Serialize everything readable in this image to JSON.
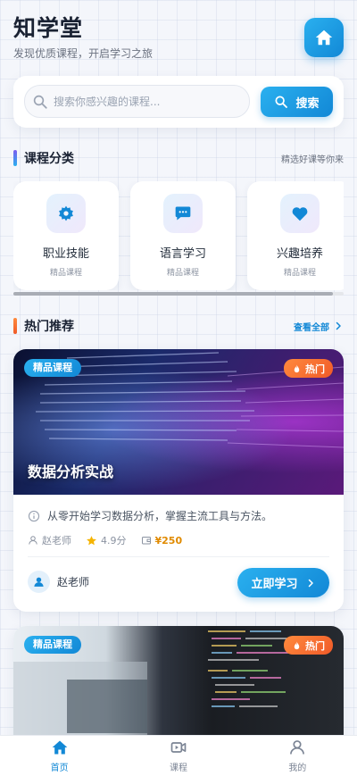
{
  "header": {
    "title": "知学堂",
    "subtitle": "发现优质课程，开启学习之旅"
  },
  "search": {
    "placeholder": "搜索你感兴趣的课程...",
    "button_label": "搜索"
  },
  "categories_section": {
    "title": "课程分类",
    "right_text": "精选好课等你来",
    "items": [
      {
        "label": "职业技能",
        "sub": "精品课程",
        "icon": "gear-icon"
      },
      {
        "label": "语言学习",
        "sub": "精品课程",
        "icon": "chat-bubble-icon"
      },
      {
        "label": "兴趣培养",
        "sub": "精品课程",
        "icon": "heart-icon"
      }
    ]
  },
  "hot_section": {
    "title": "热门推荐",
    "view_all": "查看全部"
  },
  "courses": [
    {
      "badge_left": "精品课程",
      "badge_right": "热门",
      "title": "数据分析实战",
      "description": "从零开始学习数据分析，掌握主流工具与方法。",
      "teacher": "赵老师",
      "rating": "4.9分",
      "price": "¥250",
      "button_label": "立即学习"
    },
    {
      "badge_left": "精品课程",
      "badge_right": "热门"
    }
  ],
  "bottom_nav": [
    {
      "label": "首页",
      "icon": "home-icon",
      "active": true
    },
    {
      "label": "课程",
      "icon": "video-icon",
      "active": false
    },
    {
      "label": "我的",
      "icon": "user-icon",
      "active": false
    }
  ],
  "colors": {
    "accent": "#1288d6",
    "hot": "#f05a28",
    "price": "#e08a00"
  }
}
